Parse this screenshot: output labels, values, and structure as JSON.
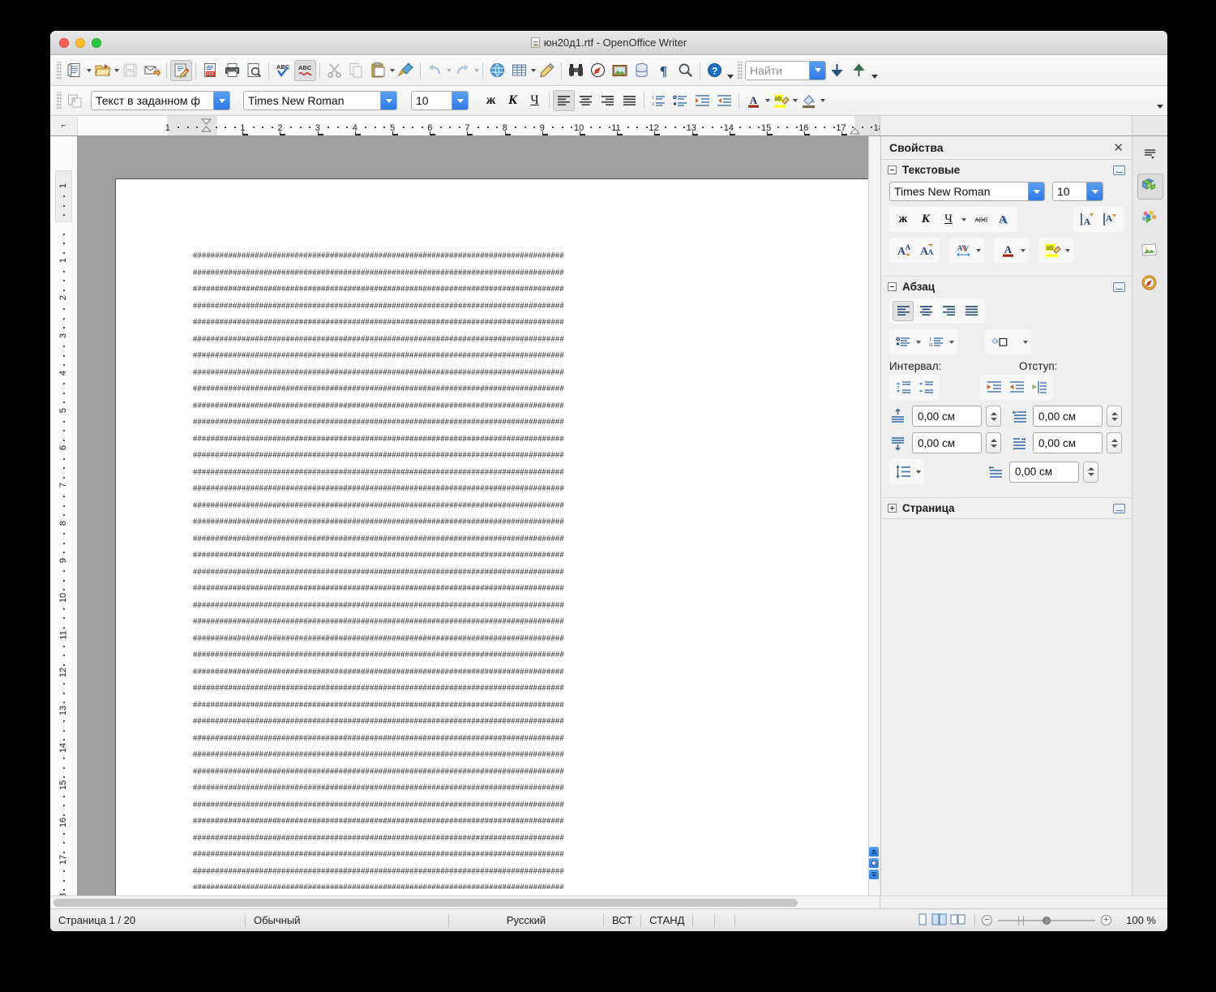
{
  "window": {
    "title": "юн20д1.rtf - OpenOffice Writer",
    "doc_icon": "rtf-document-icon",
    "traffic_lights": [
      "close",
      "minimize",
      "zoom"
    ]
  },
  "main_toolbar": {
    "items": [
      {
        "name": "new-document",
        "icon": "new-doc-icon",
        "dropdown": true,
        "enabled": true
      },
      {
        "name": "open-document",
        "icon": "open-folder-icon",
        "dropdown": true,
        "enabled": true
      },
      {
        "name": "save-document",
        "icon": "save-icon",
        "dropdown": false,
        "enabled": false
      },
      {
        "name": "send-document-as-email",
        "icon": "email-icon",
        "dropdown": false,
        "enabled": true
      },
      {
        "name": "edit-file",
        "icon": "edit-file-icon",
        "dropdown": false,
        "enabled": true,
        "pressed": true
      },
      {
        "name": "export-as-pdf",
        "icon": "pdf-icon",
        "dropdown": false,
        "enabled": true
      },
      {
        "name": "print-file-directly",
        "icon": "printer-icon",
        "dropdown": false,
        "enabled": true
      },
      {
        "name": "page-preview",
        "icon": "page-preview-icon",
        "dropdown": false,
        "enabled": true
      },
      {
        "name": "spelling-and-grammar",
        "icon": "spellcheck-icon",
        "dropdown": false,
        "enabled": true
      },
      {
        "name": "autospellcheck",
        "icon": "autospell-icon",
        "dropdown": false,
        "enabled": true,
        "pressed": true
      },
      {
        "name": "cut",
        "icon": "scissors-icon",
        "dropdown": false,
        "enabled": false
      },
      {
        "name": "copy",
        "icon": "copy-icon",
        "dropdown": false,
        "enabled": false
      },
      {
        "name": "paste",
        "icon": "clipboard-icon",
        "dropdown": true,
        "enabled": true
      },
      {
        "name": "clone-formatting",
        "icon": "paintbrush-icon",
        "dropdown": false,
        "enabled": true
      },
      {
        "name": "undo",
        "icon": "undo-arrow-icon",
        "dropdown": true,
        "enabled": false
      },
      {
        "name": "redo",
        "icon": "redo-arrow-icon",
        "dropdown": true,
        "enabled": false
      },
      {
        "name": "insert-hyperlink",
        "icon": "globe-icon",
        "dropdown": false,
        "enabled": true
      },
      {
        "name": "insert-table",
        "icon": "table-icon",
        "dropdown": true,
        "enabled": true
      },
      {
        "name": "show-draw-functions",
        "icon": "pencil-icon",
        "dropdown": false,
        "enabled": true
      },
      {
        "name": "find-and-replace",
        "icon": "binoculars-icon",
        "dropdown": false,
        "enabled": true
      },
      {
        "name": "navigator",
        "icon": "compass-icon",
        "dropdown": false,
        "enabled": true
      },
      {
        "name": "gallery",
        "icon": "picture-frame-icon",
        "dropdown": false,
        "enabled": true
      },
      {
        "name": "data-sources",
        "icon": "database-icon",
        "dropdown": false,
        "enabled": true
      },
      {
        "name": "formatting-marks",
        "icon": "pilcrow-icon",
        "dropdown": false,
        "enabled": true
      },
      {
        "name": "zoom",
        "icon": "magnifier-icon",
        "dropdown": false,
        "enabled": true
      },
      {
        "name": "openoffice-help",
        "icon": "help-question-icon",
        "dropdown": false,
        "enabled": true
      }
    ],
    "search": {
      "placeholder": "Найти",
      "value": "",
      "find-next": "find-down-arrow-icon",
      "find-previous": "find-up-arrow-icon"
    }
  },
  "format_toolbar": {
    "styles_button": "apply-style-icon",
    "paragraph_style": "Текст в заданном ф",
    "font_name": "Times New Roman",
    "font_size": "10",
    "bold": "ж",
    "italic": "К",
    "underline": "Ч",
    "align": [
      "align-left",
      "align-center",
      "align-right",
      "align-justify"
    ],
    "align_active": 0,
    "lists": [
      "numbered-list",
      "bulleted-list"
    ],
    "indent": [
      "increase-indent",
      "decrease-indent"
    ],
    "font_color": "font-color-icon",
    "highlight": "highlighting-icon",
    "background": "background-color-icon",
    "colors": {
      "font": "#9c2b16",
      "highlight": "#ffff00"
    }
  },
  "ruler": {
    "horizontal_ticks": [
      "1",
      "1",
      "2",
      "3",
      "4",
      "5",
      "6",
      "7",
      "8",
      "9",
      "10",
      "11",
      "12",
      "13",
      "14",
      "15",
      "16",
      "17",
      "1"
    ],
    "vertical_ticks": [
      "1",
      "1",
      "2",
      "3",
      "4",
      "5",
      "6",
      "7",
      "8",
      "9",
      "10",
      "11",
      "12",
      "13",
      "14",
      "15",
      "16",
      "17"
    ],
    "corner_icon": "tab-stop-left-icon",
    "unit": "cm"
  },
  "document": {
    "line_text": "####################################################################################",
    "line_count": 40
  },
  "sidebar": {
    "title": "Свойства",
    "close_icon": "close-icon",
    "panels": [
      {
        "name": "character",
        "title": "Текстовые",
        "expanded": true,
        "font_name": "Times New Roman",
        "font_size": "10",
        "bold": "ж",
        "italic": "К",
        "underline": "Ч",
        "strikethrough": "strikethrough-icon",
        "shadow": "shadow-icon",
        "superscript": "superscript-icon",
        "subscript": "subscript-icon",
        "grow_font": "increase-font-size-icon",
        "shrink_font": "decrease-font-size-icon",
        "spacing": "character-spacing-icon",
        "font_color": "font-color-icon",
        "highlight": "highlighting-icon"
      },
      {
        "name": "paragraph",
        "title": "Абзац",
        "expanded": true,
        "align_icons": [
          "align-left-icon",
          "align-center-icon",
          "align-right-icon",
          "align-justify-icon"
        ],
        "align_active": 0,
        "bullet_list": "bulleted-list-icon",
        "numbered_list": "numbered-list-icon",
        "paragraph_background": "paragraph-background-icon",
        "spacing_label": "Интервал:",
        "indent_label": "Отступ:",
        "spacing_increase": "increase-spacing-icon",
        "spacing_decrease": "decrease-spacing-icon",
        "indent_increase": "increase-indent-icon",
        "indent_decrease": "decrease-indent-icon",
        "indent_hanging": "hanging-indent-icon",
        "fields": [
          {
            "name": "space-above-paragraph",
            "icon": "space-above-icon",
            "value": "0,00 см"
          },
          {
            "name": "indent-before-text",
            "icon": "indent-before-icon",
            "value": "0,00 см"
          },
          {
            "name": "space-below-paragraph",
            "icon": "space-below-icon",
            "value": "0,00 см"
          },
          {
            "name": "indent-after-text",
            "icon": "indent-after-icon",
            "value": "0,00 см"
          },
          {
            "name": "first-line-indent",
            "icon": "first-line-indent-icon",
            "value": "0,00 см"
          }
        ],
        "line_spacing": "line-spacing-icon"
      },
      {
        "name": "page",
        "title": "Страница",
        "expanded": false
      }
    ]
  },
  "tabstrip": {
    "items": [
      {
        "name": "sidebar-settings",
        "icon": "sidebar-settings-icon",
        "selected": false
      },
      {
        "name": "properties-deck",
        "icon": "properties-cube-icon",
        "selected": true
      },
      {
        "name": "styles-and-formatting-deck",
        "icon": "styles-flower-icon",
        "selected": false
      },
      {
        "name": "gallery-deck",
        "icon": "gallery-picture-icon",
        "selected": false
      },
      {
        "name": "navigator-deck",
        "icon": "navigator-compass-icon",
        "selected": false
      }
    ]
  },
  "statusbar": {
    "page": "Страница  1 / 20",
    "page_style": "Обычный",
    "language": "Русский",
    "insert_mode": "ВСТ",
    "selection_mode": "СТАНД",
    "modified": "",
    "view_layouts": [
      "single-page-view",
      "multi-page-view",
      "book-view"
    ],
    "zoom_out": "zoom-out-icon",
    "zoom_in": "zoom-in-icon",
    "zoom_level": "100 %"
  }
}
